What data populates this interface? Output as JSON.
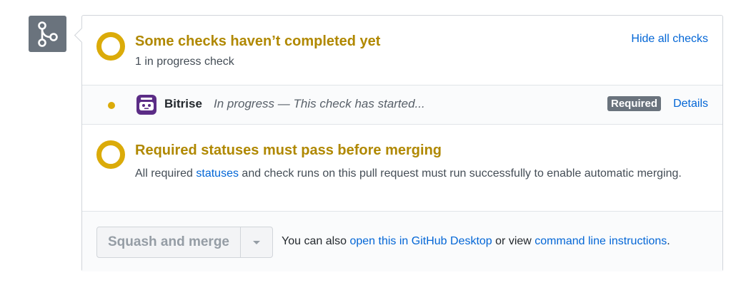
{
  "checks_summary": {
    "title": "Some checks haven’t completed yet",
    "subtitle": "1 in progress check",
    "hide_link": "Hide all checks"
  },
  "check_row": {
    "app_name": "Bitrise",
    "description": "In progress — This check has started...",
    "badge": "Required",
    "details_link": "Details",
    "app_icon": "bitrise-logo-icon"
  },
  "required_statuses": {
    "title": "Required statuses must pass before merging",
    "desc_before": "All required ",
    "desc_link": "statuses",
    "desc_after": " and check runs on this pull request must run successfully to enable automatic merging."
  },
  "merge": {
    "button_label": "Squash and merge",
    "also_prefix": "You can also ",
    "desktop_link": "open this in GitHub Desktop",
    "or_view": " or view ",
    "cli_link": "command line instructions",
    "period": "."
  },
  "colors": {
    "pending": "#dbab09",
    "pending_text": "#b08800",
    "link": "#0366d6",
    "icon_bg": "#6a737d"
  },
  "icons": {
    "merge": "git-merge-icon",
    "pending": "pending-ring-icon",
    "caret": "caret-down-icon"
  }
}
